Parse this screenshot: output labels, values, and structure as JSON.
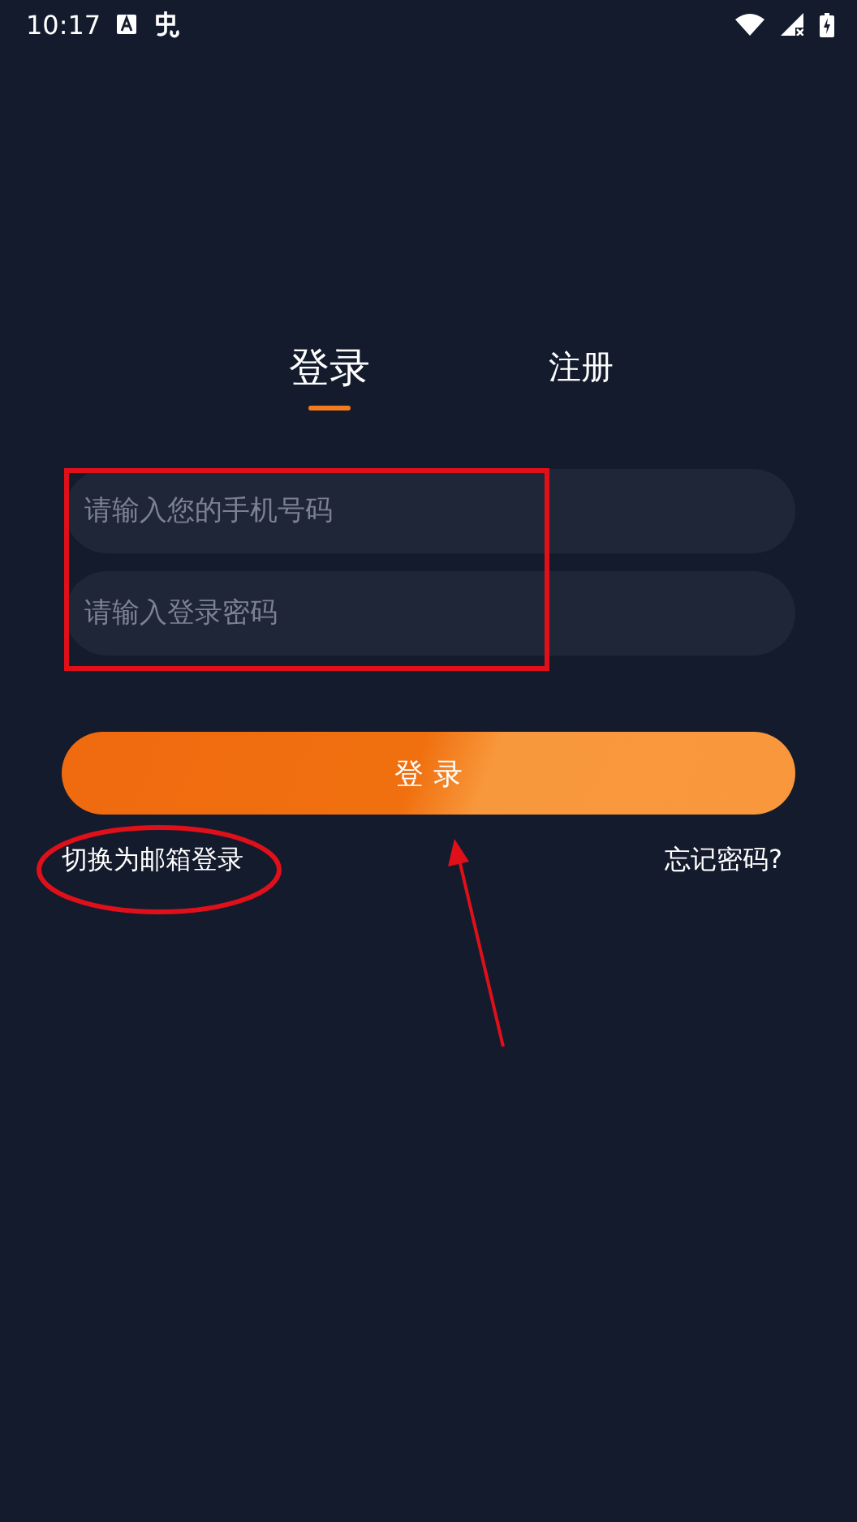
{
  "status_bar": {
    "time": "10:17"
  },
  "tabs": [
    {
      "label": "登录",
      "selected": true
    },
    {
      "label": "注册",
      "selected": false
    }
  ],
  "fields": [
    {
      "placeholder": "请输入您的手机号码"
    },
    {
      "placeholder": "请输入登录密码"
    }
  ],
  "login_button": "登 录",
  "switch_link": "切换为邮箱登录",
  "forgot_link": "忘记密码?",
  "annotations": [
    {
      "kind": "rectangle"
    },
    {
      "kind": "ellipse"
    },
    {
      "kind": "arrow"
    }
  ]
}
